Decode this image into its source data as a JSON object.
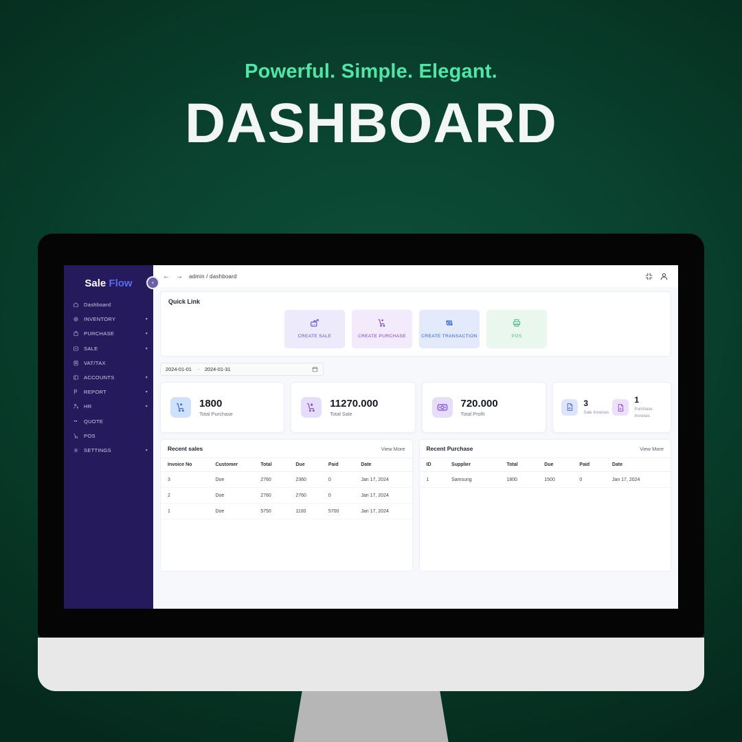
{
  "hero": {
    "tagline": "Powerful. Simple. Elegant.",
    "title": "DASHBOARD",
    "tagline_color": "#4fe6a8",
    "title_color": "#f2f6f4",
    "background_color": "#0a4431"
  },
  "sidebar": {
    "brand_first": "Sale",
    "brand_second": "Flow",
    "collapse_label": "‹",
    "items": [
      {
        "label": "Dashboard",
        "icon": "home-icon",
        "expandable": false
      },
      {
        "label": "INVENTORY",
        "icon": "box-icon",
        "expandable": true
      },
      {
        "label": "PURCHASE",
        "icon": "bag-icon",
        "expandable": true
      },
      {
        "label": "SALE",
        "icon": "minus-square-icon",
        "expandable": true
      },
      {
        "label": "VAT/TAX",
        "icon": "stamp-icon",
        "expandable": false
      },
      {
        "label": "ACCOUNTS",
        "icon": "wallet-icon",
        "expandable": true
      },
      {
        "label": "REPORT",
        "icon": "flag-icon",
        "expandable": true
      },
      {
        "label": "HR",
        "icon": "people-icon",
        "expandable": true
      },
      {
        "label": "QUOTE",
        "icon": "quote-icon",
        "expandable": false
      },
      {
        "label": "POS",
        "icon": "cart-icon",
        "expandable": false
      },
      {
        "label": "SETTINGS",
        "icon": "gear-icon",
        "expandable": true
      }
    ],
    "background_color": "#241a5c"
  },
  "topbar": {
    "back_label": "←",
    "forward_label": "→",
    "breadcrumb": "admin  /  dashboard",
    "fullscreen_icon": "compress-icon",
    "user_icon": "user-icon"
  },
  "quick_link": {
    "title": "Quick Link",
    "cards": [
      {
        "label": "CREATE SALE",
        "icon": "chart-up-icon",
        "bg": "#eceafb",
        "fg": "#5b52c9"
      },
      {
        "label": "CREATE PURCHASE",
        "icon": "cart-plus-icon",
        "bg": "#f3eafb",
        "fg": "#7d3fc9"
      },
      {
        "label": "CREATE TRANSACTION",
        "icon": "transfer-icon",
        "bg": "#e3eafb",
        "fg": "#2f5fd0"
      },
      {
        "label": "POS",
        "icon": "printer-icon",
        "bg": "#e9f7ef",
        "fg": "#4bbd85"
      }
    ]
  },
  "date_range": {
    "start": "2024-01-01",
    "end": "2024-01-31",
    "separator": "→",
    "calendar_icon": "calendar-icon"
  },
  "stats": [
    {
      "value": "1800",
      "label": "Total Purchase",
      "icon": "cart-plus-icon",
      "bg": "#cfe1fb",
      "fg": "#2f5fd0"
    },
    {
      "value": "11270.000",
      "label": "Total Sale",
      "icon": "cart-down-icon",
      "bg": "#e6ddfb",
      "fg": "#7b46cf"
    },
    {
      "value": "720.000",
      "label": "Total Profit",
      "icon": "money-icon",
      "bg": "#e6ddfb",
      "fg": "#7b46cf"
    }
  ],
  "invoice_stats": [
    {
      "value": "3",
      "label": "Sale Invoices",
      "icon": "document-icon",
      "bg": "#dde4fb",
      "fg": "#4a63d6"
    },
    {
      "value": "1",
      "label": "Purchase Invoices",
      "icon": "document-icon",
      "bg": "#ece0fb",
      "fg": "#8a4ed1"
    }
  ],
  "recent_sales": {
    "title": "Recent sales",
    "view_more": "View More",
    "columns": [
      "Invoice No",
      "Customer",
      "Total",
      "Due",
      "Paid",
      "Date"
    ],
    "rows": [
      [
        "3",
        "Doe",
        "2760",
        "2360",
        "0",
        "Jan 17, 2024"
      ],
      [
        "2",
        "Doe",
        "2760",
        "2760",
        "0",
        "Jan 17, 2024"
      ],
      [
        "1",
        "Doe",
        "5750",
        "1100",
        "5700",
        "Jan 17, 2024"
      ]
    ]
  },
  "recent_purchase": {
    "title": "Recent Purchase",
    "view_more": "View More",
    "columns": [
      "ID",
      "Supplier",
      "Total",
      "Due",
      "Paid",
      "Date"
    ],
    "rows": [
      [
        "1",
        "Samsung",
        "1800",
        "1500",
        "0",
        "Jan 17, 2024"
      ]
    ]
  }
}
